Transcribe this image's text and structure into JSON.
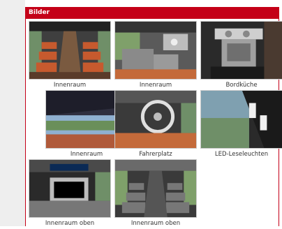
{
  "section": {
    "title": "Bilder"
  },
  "colors": {
    "header_bg": "#c40018",
    "header_text": "#ffffff",
    "caption_text": "#333333",
    "page_bg": "#eeeeee"
  },
  "gallery": [
    {
      "caption": "Innenraum",
      "icon": "bus-interior-seats-image"
    },
    {
      "caption": "Innenraum",
      "icon": "bus-table-seats-image"
    },
    {
      "caption": "Bordküche",
      "icon": "bus-galley-kitchen-image"
    },
    {
      "caption": "Innenraum",
      "icon": "bus-overhead-shelf-image"
    },
    {
      "caption": "Fahrerplatz",
      "icon": "driver-seat-steering-image"
    },
    {
      "caption": "LED-Leseleuchten",
      "icon": "led-reading-lights-image"
    },
    {
      "caption": "Innenraum oben",
      "icon": "upper-deck-monitor-image"
    },
    {
      "caption": "Innenraum oben",
      "icon": "upper-deck-seats-image"
    }
  ]
}
